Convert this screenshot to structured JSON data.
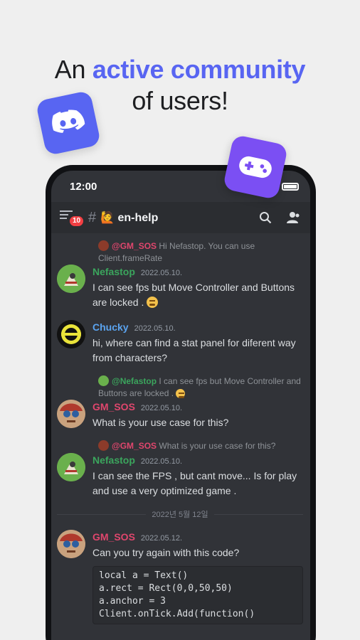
{
  "headline": {
    "prefix": "An ",
    "accent": "active community",
    "line2": "of users!"
  },
  "status_bar": {
    "time": "12:00"
  },
  "channel": {
    "hash": "#",
    "name": "🙋 en-help",
    "notification_count": "10"
  },
  "messages": [
    {
      "reply": {
        "author": "@GM_SOS",
        "text": "Hi Nefastop. You can use Client.frameRate"
      },
      "author": "Nefastop",
      "author_color": "#3ba55d",
      "timestamp": "2022.05.10.",
      "text": "I can see fps but Move Controller and Buttons are locked ."
    },
    {
      "author": "Chucky",
      "author_color": "#5ba4f0",
      "timestamp": "2022.05.10.",
      "text": "hi, where can find a stat panel for diferent way from characters?"
    },
    {
      "reply": {
        "author": "@Nefastop",
        "text": "I can see fps but Move Controller and Buttons are locked ."
      },
      "author": "GM_SOS",
      "author_color": "#e0466d",
      "timestamp": "2022.05.10.",
      "text": "What is your use case for this?"
    },
    {
      "reply": {
        "author": "@GM_SOS",
        "text": "What is your use case for this?"
      },
      "author": "Nefastop",
      "author_color": "#3ba55d",
      "timestamp": "2022.05.10.",
      "text": "I can see the FPS , but cant move... Is for play and use a very optimized game ."
    },
    {
      "author": "GM_SOS",
      "author_color": "#e0466d",
      "timestamp": "2022.05.12.",
      "text": "Can you try again with this code?",
      "code": "local a = Text()\na.rect = Rect(0,0,50,50)\na.anchor = 3\nClient.onTick.Add(function()"
    }
  ],
  "date_divider": "2022년 5월 12일",
  "colors": {
    "accent": "#5865f2",
    "game_badge": "#7b4ff3",
    "background": "#313338"
  },
  "icons": [
    "discord-logo-icon",
    "gamepad-icon",
    "menu-icon",
    "search-icon",
    "members-icon",
    "wifi-icon",
    "battery-icon"
  ]
}
